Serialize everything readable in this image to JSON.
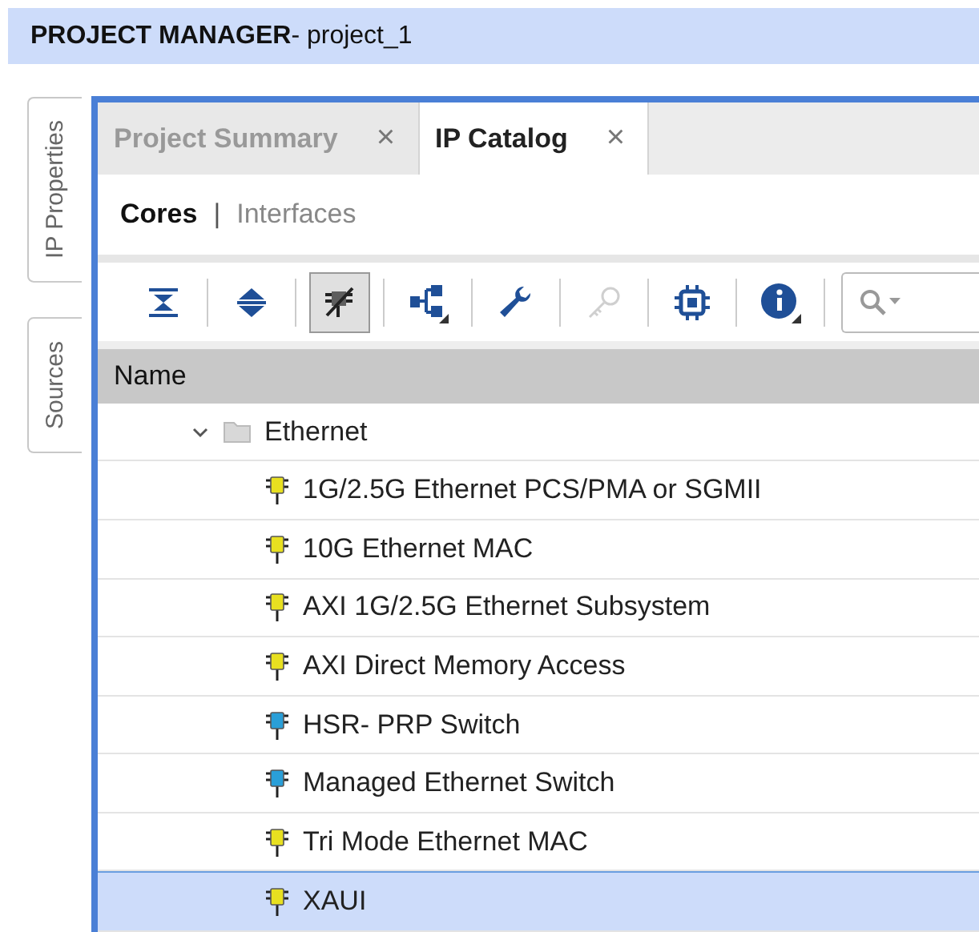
{
  "window": {
    "title": "PROJECT MANAGER",
    "subtitle": " - project_1"
  },
  "side_tabs": [
    {
      "label": "IP Properties"
    },
    {
      "label": "Sources"
    }
  ],
  "tabs": [
    {
      "label": "Project Summary",
      "close": "×",
      "selected": false
    },
    {
      "label": "IP Catalog",
      "close": "×",
      "selected": true
    }
  ],
  "views": [
    {
      "label": "Cores",
      "selected": true
    },
    {
      "label": "Interfaces",
      "selected": false
    }
  ],
  "view_separator": "|",
  "toolbar": [
    {
      "kind": "collapse",
      "pressed": false,
      "disabled": false
    },
    {
      "kind": "expand",
      "pressed": false,
      "disabled": false
    },
    {
      "kind": "filter",
      "pressed": true,
      "disabled": false
    },
    {
      "kind": "hierarchy",
      "pressed": false,
      "disabled": false
    },
    {
      "kind": "wrench",
      "pressed": false,
      "disabled": false
    },
    {
      "kind": "key",
      "pressed": false,
      "disabled": true
    },
    {
      "kind": "chip",
      "pressed": false,
      "disabled": false
    },
    {
      "kind": "info",
      "pressed": false,
      "disabled": false
    }
  ],
  "table": {
    "columns": [
      "Name"
    ],
    "tree": [
      {
        "label": "Ethernet",
        "expanded": true,
        "children": [
          {
            "label": "1G/2.5G Ethernet PCS/PMA or SGMII",
            "color": "#e8e020",
            "selected": false
          },
          {
            "label": "10G Ethernet MAC",
            "color": "#e8e020",
            "selected": false
          },
          {
            "label": "AXI 1G/2.5G Ethernet Subsystem",
            "color": "#e8e020",
            "selected": false
          },
          {
            "label": "AXI Direct Memory Access",
            "color": "#e8e020",
            "selected": false
          },
          {
            "label": "HSR- PRP Switch",
            "color": "#2a9fd8",
            "selected": false
          },
          {
            "label": "Managed Ethernet Switch",
            "color": "#2a9fd8",
            "selected": false
          },
          {
            "label": "Tri Mode Ethernet MAC",
            "color": "#e8e020",
            "selected": false
          },
          {
            "label": "XAUI",
            "color": "#e8e020",
            "selected": true
          }
        ]
      }
    ]
  }
}
